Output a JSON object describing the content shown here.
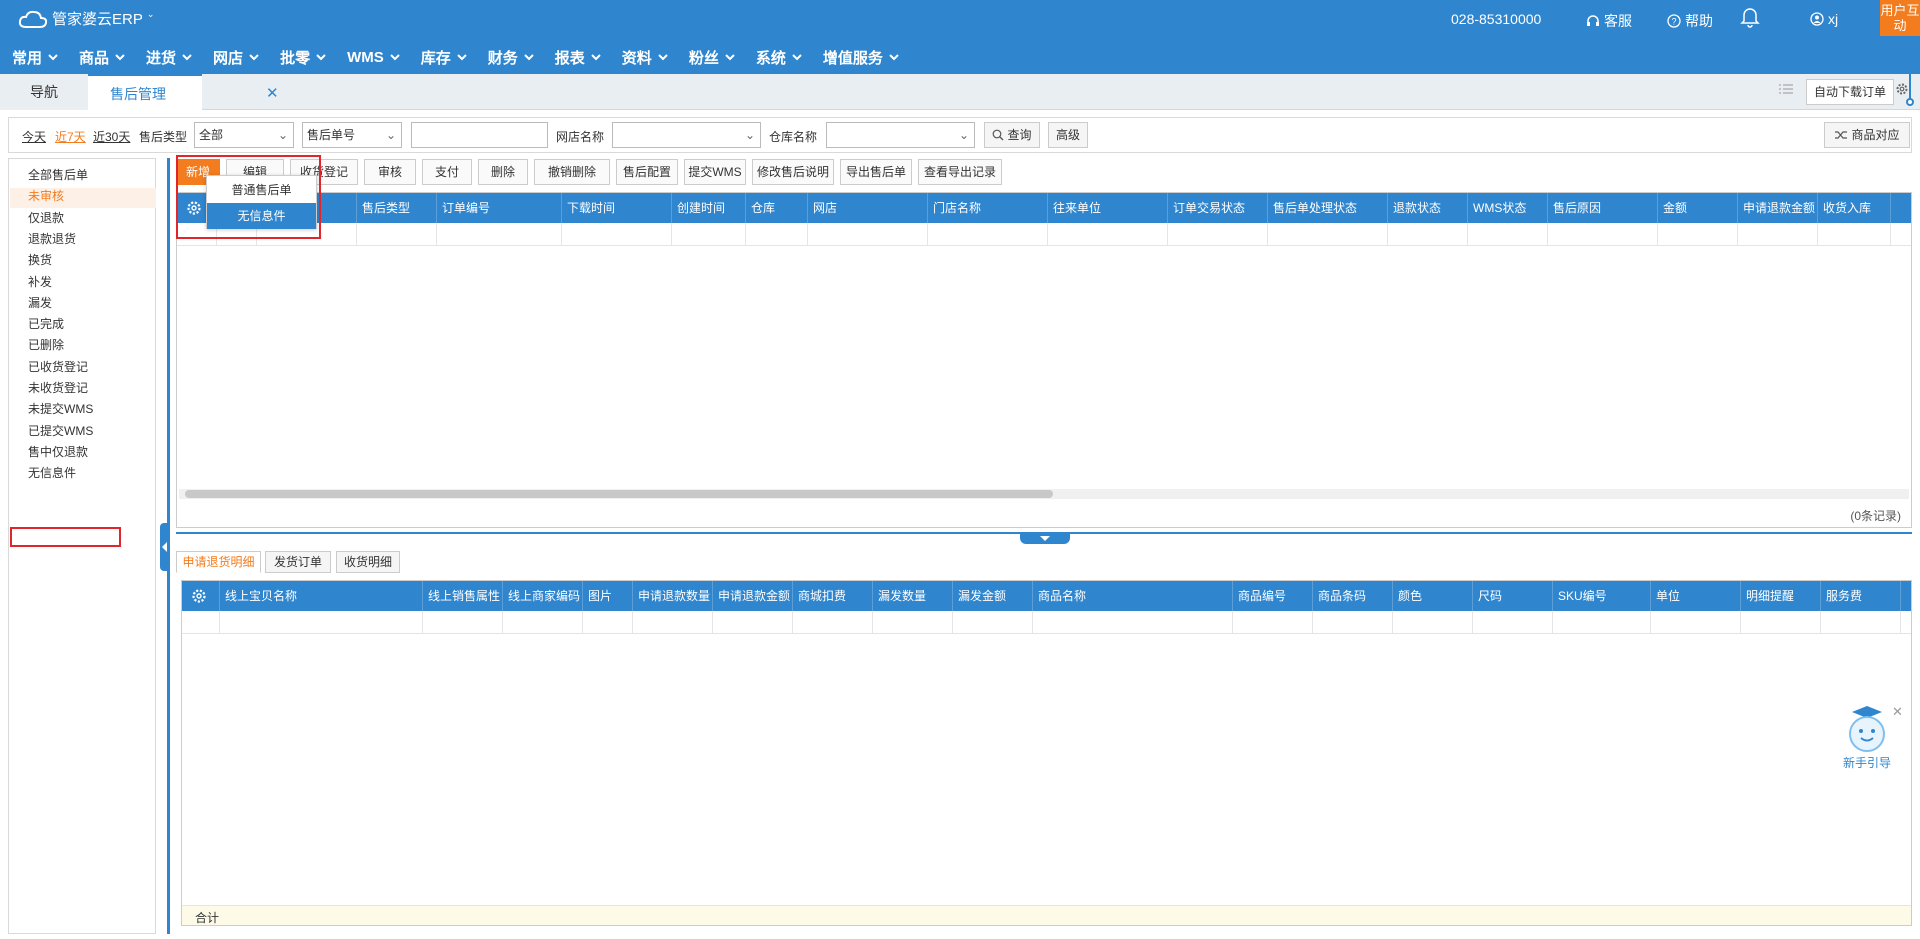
{
  "app": {
    "title": "管家婆云ERP"
  },
  "topbar": {
    "phone": "028-85310000",
    "service": "客服",
    "help": "帮助",
    "user": "xj",
    "user_interact": "用户互动"
  },
  "nav": {
    "items": [
      "常用",
      "商品",
      "进货",
      "网店",
      "批零",
      "WMS",
      "库存",
      "财务",
      "报表",
      "资料",
      "粉丝",
      "系统",
      "增值服务"
    ]
  },
  "tabs": {
    "nav": "导航",
    "after_sale": "售后管理",
    "auto_download": "自动下载订单"
  },
  "filter": {
    "today": "今天",
    "last7": "近7天",
    "last30": "近30天",
    "type_label": "售后类型",
    "type_value": "全部",
    "search_field": "售后单号",
    "search_value": "",
    "shop_label": "网店名称",
    "shop_value": "",
    "warehouse_label": "仓库名称",
    "warehouse_value": "",
    "query": "查询",
    "advanced": "高级",
    "product_match": "商品对应"
  },
  "left": {
    "items": [
      "全部售后单",
      "未审核",
      "仅退款",
      "退款退货",
      "换货",
      "补发",
      "漏发",
      "已完成",
      "已删除",
      "已收货登记",
      "未收货登记",
      "未提交WMS",
      "已提交WMS",
      "售中仅退款",
      "无信息件"
    ],
    "active_index": 1
  },
  "toolbar": {
    "buttons": [
      "新增",
      "编辑",
      "收货登记",
      "审核",
      "支付",
      "删除",
      "撤销删除",
      "售后配置",
      "提交WMS",
      "修改售后说明",
      "导出售后单",
      "查看导出记录"
    ]
  },
  "dropdown": {
    "items": [
      "普通售后单",
      "无信息件"
    ],
    "highlight_index": 1
  },
  "main_grid": {
    "columns": [
      "",
      "",
      "",
      "售后类型",
      "订单编号",
      "下载时间",
      "创建时间",
      "仓库",
      "网店",
      "门店名称",
      "往来单位",
      "订单交易状态",
      "售后单处理状态",
      "退款状态",
      "WMS状态",
      "售后原因",
      "金额",
      "申请退款金额",
      "收货入库"
    ],
    "record_count": "(0条记录)"
  },
  "bottom_tabs": [
    "申请退货明细",
    "发货订单",
    "收货明细"
  ],
  "bottom_grid": {
    "columns": [
      "",
      "线上宝贝名称",
      "线上销售属性",
      "线上商家编码",
      "图片",
      "申请退款数量",
      "申请退款金额",
      "商城扣费",
      "漏发数量",
      "漏发金额",
      "商品名称",
      "商品编号",
      "商品条码",
      "颜色",
      "尺码",
      "SKU编号",
      "单位",
      "明细提醒",
      "服务费"
    ],
    "sum_label": "合计"
  },
  "guide": {
    "label": "新手引导"
  },
  "colors": {
    "primary": "#2f86cf",
    "accent": "#f27c1e",
    "highlight_border": "#e0262b"
  }
}
